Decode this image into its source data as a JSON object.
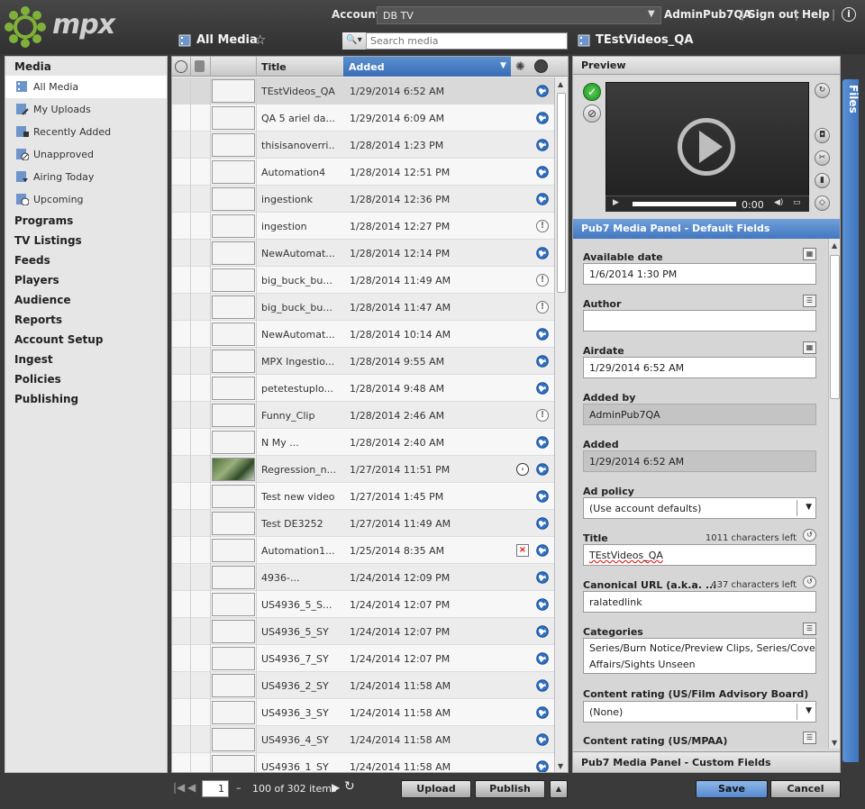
{
  "brand": {
    "logo_text": "mpx"
  },
  "header": {
    "account_label": "Account:",
    "account_value": "DB TV",
    "user": "AdminPub7QA",
    "signout": "Sign out",
    "help": "Help",
    "separator": "|",
    "info": "i"
  },
  "list_title": "All Media",
  "search": {
    "placeholder": "Search media"
  },
  "sidebar": {
    "media_heading": "Media",
    "media_items": [
      {
        "label": "All Media",
        "icon": "film-icon"
      },
      {
        "label": "My Uploads",
        "icon": "upload-icon"
      },
      {
        "label": "Recently Added",
        "icon": "add-icon"
      },
      {
        "label": "Unapproved",
        "icon": "unapproved-icon"
      },
      {
        "label": "Airing Today",
        "icon": "airing-icon"
      },
      {
        "label": "Upcoming",
        "icon": "upcoming-icon"
      }
    ],
    "sections": [
      "Programs",
      "TV Listings",
      "Feeds",
      "Players",
      "Audience",
      "Reports",
      "Account Setup",
      "Ingest",
      "Policies",
      "Publishing"
    ]
  },
  "table": {
    "col_title": "Title",
    "col_added": "Added",
    "rows": [
      {
        "title": "TEstVideos_QA",
        "added": "1/29/2014 6:52 AM",
        "status": "globe",
        "thumb": false
      },
      {
        "title": "QA 5 ariel da...",
        "added": "1/29/2014 6:09 AM",
        "status": "globe",
        "thumb": false
      },
      {
        "title": "thisisanoverri...",
        "added": "1/28/2014 1:23 PM",
        "status": "globe",
        "thumb": false
      },
      {
        "title": "Automation4",
        "added": "1/28/2014 12:51 PM",
        "status": "globe",
        "thumb": false
      },
      {
        "title": "ingestionk",
        "added": "1/28/2014 12:36 PM",
        "status": "globe",
        "thumb": false
      },
      {
        "title": "ingestion",
        "added": "1/28/2014 12:27 PM",
        "status": "warn",
        "thumb": false
      },
      {
        "title": "NewAutomat...",
        "added": "1/28/2014 12:14 PM",
        "status": "globe",
        "thumb": false
      },
      {
        "title": "big_buck_bu...",
        "added": "1/28/2014 11:49 AM",
        "status": "warn",
        "thumb": false
      },
      {
        "title": "big_buck_bu...",
        "added": "1/28/2014 11:47 AM",
        "status": "warn",
        "thumb": false
      },
      {
        "title": "NewAutomat...",
        "added": "1/28/2014 10:14 AM",
        "status": "globe",
        "thumb": false
      },
      {
        "title": "MPX Ingestio...",
        "added": "1/28/2014 9:55 AM",
        "status": "globe",
        "thumb": false
      },
      {
        "title": "petetestuplo...",
        "added": "1/28/2014 9:48 AM",
        "status": "globe",
        "thumb": false
      },
      {
        "title": "Funny_Clip",
        "added": "1/28/2014 2:46 AM",
        "status": "warn",
        "thumb": false
      },
      {
        "title": "N My ...",
        "added": "1/28/2014 2:40 AM",
        "status": "globe",
        "thumb": false
      },
      {
        "title": "Regression_n...",
        "added": "1/27/2014 11:51 PM",
        "status": "globe",
        "thumb": true,
        "extra": "clock"
      },
      {
        "title": "Test new video",
        "added": "1/27/2014 1:45 PM",
        "status": "globe",
        "thumb": false
      },
      {
        "title": "Test DE3252",
        "added": "1/27/2014 11:49 AM",
        "status": "globe",
        "thumb": false
      },
      {
        "title": "Automation1...",
        "added": "1/25/2014 8:35 AM",
        "status": "globe",
        "thumb": false,
        "extra": "error"
      },
      {
        "title": "4936-...",
        "added": "1/24/2014 12:09 PM",
        "status": "globe",
        "thumb": false
      },
      {
        "title": "US4936_5_S...",
        "added": "1/24/2014 12:07 PM",
        "status": "globe",
        "thumb": false
      },
      {
        "title": "US4936_5_SY",
        "added": "1/24/2014 12:07 PM",
        "status": "globe",
        "thumb": false
      },
      {
        "title": "US4936_7_SY",
        "added": "1/24/2014 12:07 PM",
        "status": "globe",
        "thumb": false
      },
      {
        "title": "US4936_2_SY",
        "added": "1/24/2014 11:58 AM",
        "status": "globe",
        "thumb": false
      },
      {
        "title": "US4936_3_SY",
        "added": "1/24/2014 11:58 AM",
        "status": "globe",
        "thumb": false
      },
      {
        "title": "US4936_4_SY",
        "added": "1/24/2014 11:58 AM",
        "status": "globe",
        "thumb": false
      },
      {
        "title": "US4936_1_SY",
        "added": "1/24/2014 11:58 AM",
        "status": "globe",
        "thumb": false
      }
    ]
  },
  "footer": {
    "page": "1",
    "paging": "100 of 302 items",
    "dash": "–",
    "upload": "Upload",
    "publish": "Publish"
  },
  "detail": {
    "title": "TEstVideos_QA",
    "preview_label": "Preview",
    "player_time": "0:00",
    "panel_title": "Pub7 Media Panel - Default Fields",
    "fields": {
      "available_date_label": "Available date",
      "available_date": "1/6/2014 1:30 PM",
      "author_label": "Author",
      "author": "",
      "airdate_label": "Airdate",
      "airdate": "1/29/2014 6:52 AM",
      "added_by_label": "Added by",
      "added_by": "AdminPub7QA",
      "added_label": "Added",
      "added": "1/29/2014 6:52 AM",
      "ad_policy_label": "Ad policy",
      "ad_policy": "(Use account defaults)",
      "title_label": "Title",
      "title_count": "1011 characters left",
      "title_value": "TEstVideos_QA",
      "canonical_label": "Canonical URL (a.k.a. ...",
      "canonical_count": "437 characters left",
      "canonical_value": "ralatedlink",
      "categories_label": "Categories",
      "categories_line1": "Series/Burn Notice/Preview Clips, Series/Covert",
      "categories_line2": "Affairs/Sights Unseen",
      "rating_fab_label": "Content rating (US/Film Advisory Board)",
      "rating_fab": "(None)",
      "rating_mpaa_label": "Content rating (US/MPAA)"
    },
    "custom_panel_title": "Pub7 Media Panel - Custom Fields",
    "files_tab": "Files",
    "save": "Save",
    "cancel": "Cancel"
  },
  "colors": {
    "accent": "#4a7fc6",
    "approved": "#2aa52a"
  }
}
